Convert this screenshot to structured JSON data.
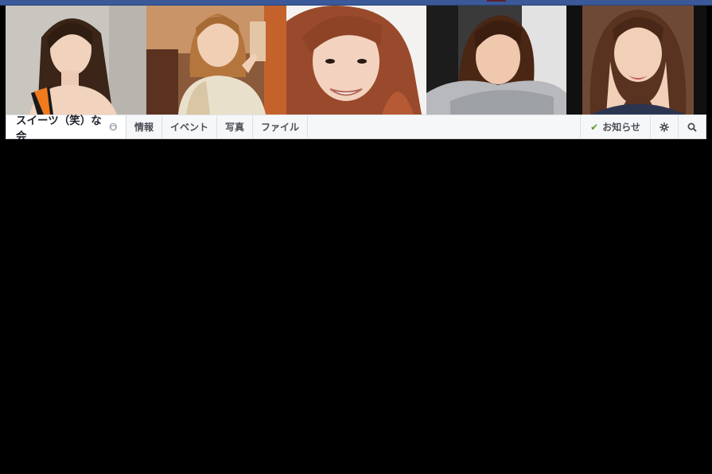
{
  "group": {
    "name": "スイーツ（笑）な会",
    "privacy_icon": "lock-icon"
  },
  "tabs": [
    {
      "label": "情報"
    },
    {
      "label": "イベント"
    },
    {
      "label": "写真"
    },
    {
      "label": "ファイル"
    }
  ],
  "actions": {
    "notify_label": "お知らせ",
    "notify_icon": "check-icon",
    "settings_icon": "gear-icon",
    "search_icon": "search-icon"
  },
  "colors": {
    "topbar": "#3b5998",
    "check": "#5b9a27"
  }
}
